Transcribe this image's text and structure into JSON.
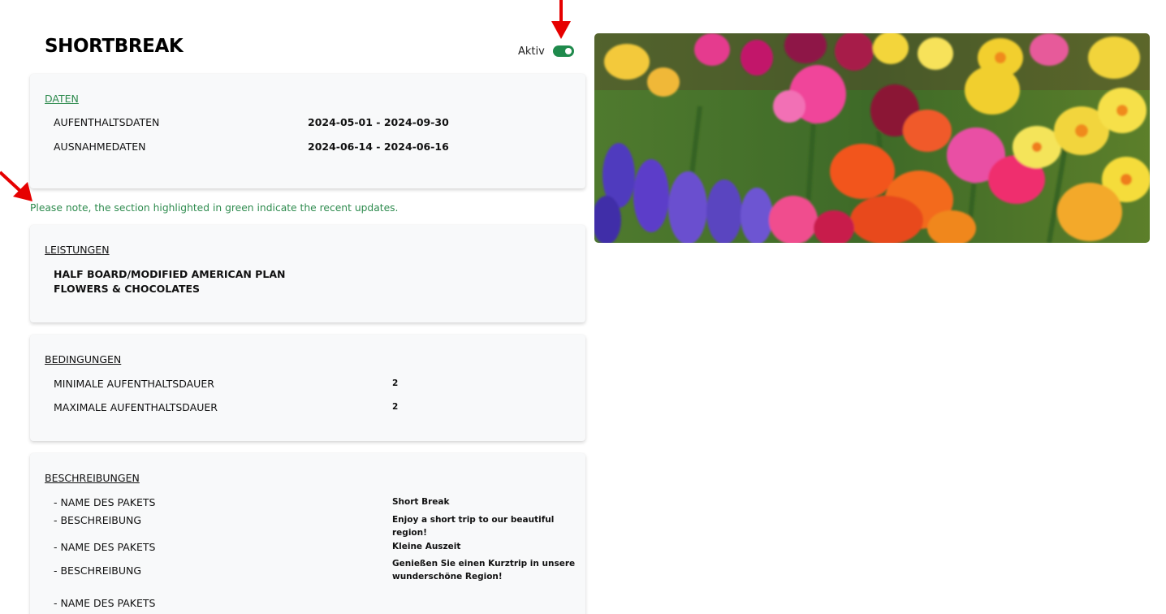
{
  "header": {
    "title": "SHORTBREAK",
    "toggle_label": "Aktiv",
    "toggle_on": true
  },
  "colors": {
    "accent_green": "#2e8b4e",
    "toggle_green": "#1f8a4c",
    "card_bg": "#f8f9fa",
    "annotation_red": "#e60000"
  },
  "daten": {
    "heading": "DATEN",
    "rows": [
      {
        "label": "AUFENTHALTSDATEN",
        "value": "2024-05-01 - 2024-09-30"
      },
      {
        "label": "AUSNAHMEDATEN",
        "value": "2024-06-14 - 2024-06-16"
      }
    ]
  },
  "note": "Please note, the section highlighted in green indicate the recent updates.",
  "leistungen": {
    "heading": "LEISTUNGEN",
    "items": [
      "HALF BOARD/MODIFIED AMERICAN PLAN",
      "FLOWERS & CHOCOLATES"
    ]
  },
  "bedingungen": {
    "heading": "BEDINGUNGEN",
    "rows": [
      {
        "label": "MINIMALE AUFENTHALTSDAUER",
        "value": "2"
      },
      {
        "label": "MAXIMALE AUFENTHALTSDAUER",
        "value": "2"
      }
    ]
  },
  "beschreibungen": {
    "heading": "BESCHREIBUNGEN",
    "entries": [
      {
        "name_label": "- NAME DES PAKETS",
        "name_value": "Short Break",
        "desc_label": "- BESCHREIBUNG",
        "desc_value": "Enjoy a short trip to our beautiful region!"
      },
      {
        "name_label": "- NAME DES PAKETS",
        "name_value": "Kleine Auszeit",
        "desc_label": "- BESCHREIBUNG",
        "desc_value_1": "Genießen Sie einen Kurztrip in unsere",
        "desc_value_2": "wunderschöne Region!"
      },
      {
        "name_label": "- NAME DES PAKETS"
      }
    ]
  },
  "icons": {
    "hero_image": "flowers-photo-image",
    "annotation_arrows": "red-arrow-icon"
  }
}
